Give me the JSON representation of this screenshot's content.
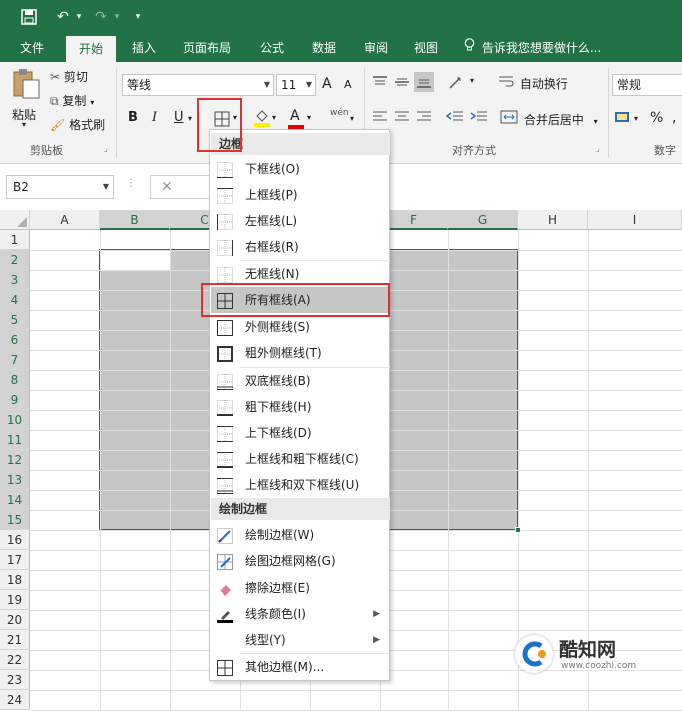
{
  "qat": {
    "save": "🖫",
    "undo": "↶",
    "redo": "↷",
    "more": "▾"
  },
  "tabs": [
    "文件",
    "开始",
    "插入",
    "页面布局",
    "公式",
    "数据",
    "审阅",
    "视图"
  ],
  "tell_me": "告诉我您想要做什么...",
  "ribbon": {
    "paste": "粘贴",
    "cut": "剪切",
    "copy": "复制",
    "format_painter": "格式刷",
    "clipboard_group": "剪贴板",
    "font_name": "等线",
    "font_size": "11",
    "grow_font": "A",
    "shrink_font": "A",
    "bold": "B",
    "italic": "I",
    "underline": "U",
    "font_color_letter": "A",
    "phonetic": "wén",
    "wrap_text": "自动换行",
    "merge_center": "合并后居中",
    "alignment_group": "对齐方式",
    "number_format": "常规",
    "percent": "%",
    "number_group": "数字"
  },
  "name_box": "B2",
  "formula_cancel": "✕",
  "columns": [
    "A",
    "B",
    "C",
    "D",
    "E",
    "F",
    "G",
    "H",
    "I"
  ],
  "rows": [
    "1",
    "2",
    "3",
    "4",
    "5",
    "6",
    "7",
    "8",
    "9",
    "10",
    "11",
    "12",
    "13",
    "14",
    "15",
    "16",
    "17",
    "18",
    "19",
    "20",
    "21",
    "22",
    "23",
    "24"
  ],
  "border_menu": {
    "header1": "边框",
    "items1": [
      "下框线(O)",
      "上框线(P)",
      "左框线(L)",
      "右框线(R)",
      "无框线(N)",
      "所有框线(A)",
      "外侧框线(S)",
      "粗外侧框线(T)",
      "双底框线(B)",
      "粗下框线(H)",
      "上下框线(D)",
      "上框线和粗下框线(C)",
      "上框线和双下框线(U)"
    ],
    "header2": "绘制边框",
    "items2": [
      "绘制边框(W)",
      "绘图边框网格(G)",
      "擦除边框(E)",
      "线条颜色(I)",
      "线型(Y)",
      "其他边框(M)..."
    ]
  },
  "watermark": {
    "brand": "酷知网",
    "url": "www.coozhi.com"
  },
  "colors": {
    "excel_green": "#217346",
    "highlight_red": "#e03030",
    "selection_gray": "#c6c6c6"
  }
}
